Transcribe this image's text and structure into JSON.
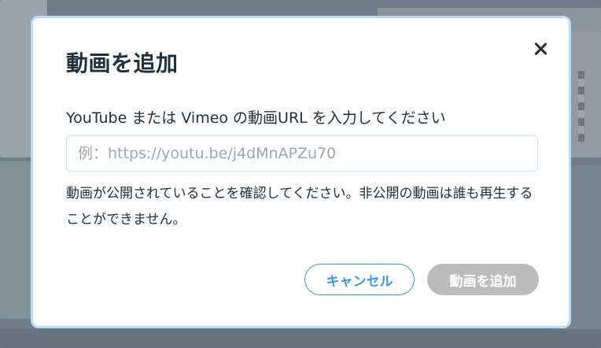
{
  "dialog": {
    "title": "動画を追加",
    "label": "YouTube または Vimeo の動画URL を入力してください",
    "url_input": {
      "value": "",
      "placeholder": "例：https://youtu.be/j4dMnAPZu70"
    },
    "note": "動画が公開されていることを確認してください。非公開の動画は誰も再生することができません。",
    "cancel_label": "キャンセル",
    "add_label": "動画を追加"
  },
  "colors": {
    "accent": "#3899ec",
    "disabled_button": "#bcbcbc",
    "modal_border": "#b7dcf8",
    "text": "#20303c"
  },
  "icons": {
    "close": "close-icon"
  }
}
